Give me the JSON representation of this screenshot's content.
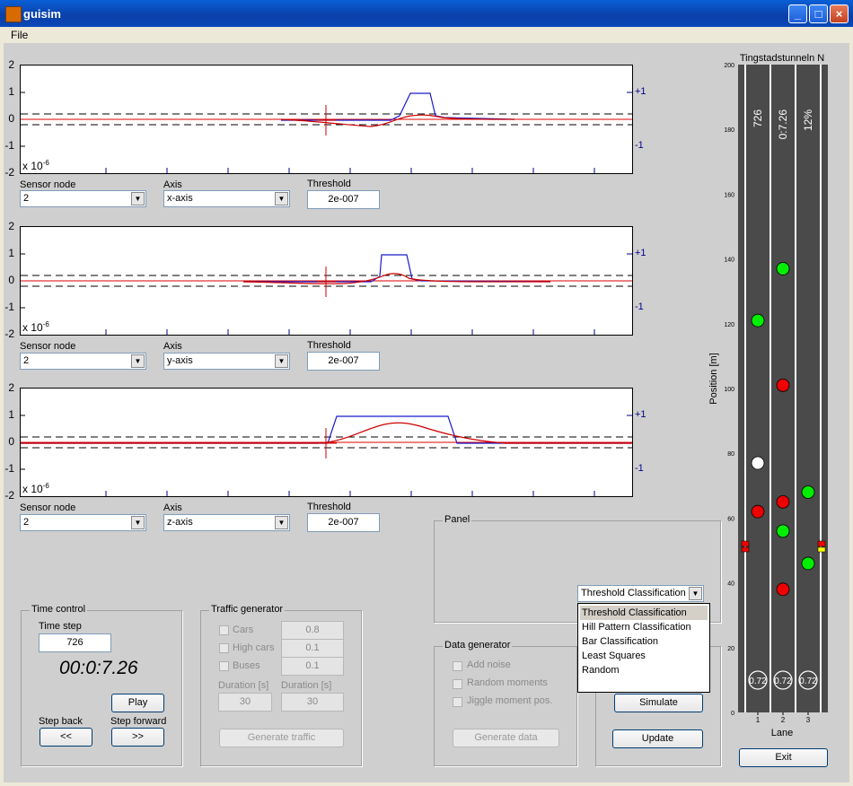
{
  "window": {
    "title": "guisim",
    "minimize": "_",
    "maximize": "□",
    "close": "×"
  },
  "menu": {
    "file": "File"
  },
  "plots": [
    {
      "yticks": [
        "2",
        "1",
        "0",
        "-1",
        "-2"
      ],
      "right_ticks": [
        "+1",
        "-1"
      ],
      "exponent": "x 10",
      "exponent_power": "-6",
      "sensor_label": "Sensor node",
      "sensor_value": "2",
      "axis_label": "Axis",
      "axis_value": "x-axis",
      "threshold_label": "Threshold",
      "threshold_value": "2e-007"
    },
    {
      "yticks": [
        "2",
        "1",
        "0",
        "-1",
        "-2"
      ],
      "right_ticks": [
        "+1",
        "-1"
      ],
      "exponent": "x 10",
      "exponent_power": "-6",
      "sensor_label": "Sensor node",
      "sensor_value": "2",
      "axis_label": "Axis",
      "axis_value": "y-axis",
      "threshold_label": "Threshold",
      "threshold_value": "2e-007"
    },
    {
      "yticks": [
        "2",
        "1",
        "0",
        "-1",
        "-2"
      ],
      "right_ticks": [
        "+1",
        "-1"
      ],
      "exponent": "x 10",
      "exponent_power": "-6",
      "sensor_label": "Sensor node",
      "sensor_value": "2",
      "axis_label": "Axis",
      "axis_value": "z-axis",
      "threshold_label": "Threshold",
      "threshold_value": "2e-007"
    }
  ],
  "time_control": {
    "title": "Time control",
    "time_step_label": "Time step",
    "time_step_value": "726",
    "clock": "00:0:7.26",
    "play": "Play",
    "step_back_label": "Step back",
    "step_forward_label": "Step forward",
    "back_button": "<<",
    "forward_button": ">>"
  },
  "traffic_generator": {
    "title": "Traffic generator",
    "cars": "Cars",
    "cars_value": "0.8",
    "high_cars": "High cars",
    "high_cars_value": "0.1",
    "buses": "Buses",
    "buses_value": "0.1",
    "duration_label_1": "Duration [s]",
    "duration_label_2": "Duration [s]",
    "duration_1": "30",
    "duration_2": "30",
    "generate": "Generate traffic"
  },
  "panel": {
    "title": "Panel"
  },
  "data_generator": {
    "title": "Data generator",
    "add_noise": "Add noise",
    "random_moments": "Random moments",
    "jiggle": "Jiggle moment pos.",
    "generate": "Generate data"
  },
  "classification": {
    "selected": "Threshold Classification",
    "options": [
      "Threshold Classification",
      "Hill Pattern Classification",
      "Bar Classification",
      "Least Squares",
      "Random"
    ]
  },
  "buttons": {
    "simulate": "Simulate",
    "update": "Update",
    "exit": "Exit"
  },
  "road": {
    "title": "Tingstadstunneln N",
    "ylabel": "Position [m]",
    "xlabel": "Lane",
    "yticks": [
      "200",
      "180",
      "160",
      "140",
      "120",
      "100",
      "80",
      "60",
      "40",
      "20",
      "0"
    ],
    "lanes": [
      "1",
      "2",
      "3"
    ],
    "lane_texts": [
      "726",
      "0:7.26",
      "12%"
    ],
    "bottom_labels": [
      "0.72",
      "0.72",
      "0.72"
    ],
    "colors": {
      "road": "#4a4a4a",
      "lane_line": "#ffffff",
      "green": "#00ee00",
      "red": "#ee0000",
      "white": "#ffffff"
    },
    "vehicles": [
      {
        "lane": 1,
        "position": 121,
        "color": "green"
      },
      {
        "lane": 1,
        "position": 77,
        "color": "white"
      },
      {
        "lane": 1,
        "position": 62,
        "color": "red"
      },
      {
        "lane": 2,
        "position": 137,
        "color": "green"
      },
      {
        "lane": 2,
        "position": 101,
        "color": "red"
      },
      {
        "lane": 2,
        "position": 65,
        "color": "red"
      },
      {
        "lane": 2,
        "position": 56,
        "color": "green"
      },
      {
        "lane": 2,
        "position": 38,
        "color": "red"
      },
      {
        "lane": 3,
        "position": 68,
        "color": "green"
      },
      {
        "lane": 3,
        "position": 46,
        "color": "green"
      }
    ]
  }
}
